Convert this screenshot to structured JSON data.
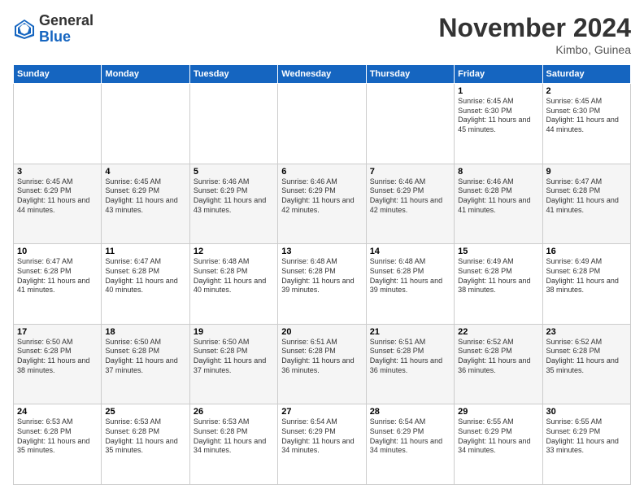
{
  "logo": {
    "general": "General",
    "blue": "Blue"
  },
  "header": {
    "month_title": "November 2024",
    "location": "Kimbo, Guinea"
  },
  "weekdays": [
    "Sunday",
    "Monday",
    "Tuesday",
    "Wednesday",
    "Thursday",
    "Friday",
    "Saturday"
  ],
  "weeks": [
    [
      {
        "day": "",
        "info": ""
      },
      {
        "day": "",
        "info": ""
      },
      {
        "day": "",
        "info": ""
      },
      {
        "day": "",
        "info": ""
      },
      {
        "day": "",
        "info": ""
      },
      {
        "day": "1",
        "info": "Sunrise: 6:45 AM\nSunset: 6:30 PM\nDaylight: 11 hours and 45 minutes."
      },
      {
        "day": "2",
        "info": "Sunrise: 6:45 AM\nSunset: 6:30 PM\nDaylight: 11 hours and 44 minutes."
      }
    ],
    [
      {
        "day": "3",
        "info": "Sunrise: 6:45 AM\nSunset: 6:29 PM\nDaylight: 11 hours and 44 minutes."
      },
      {
        "day": "4",
        "info": "Sunrise: 6:45 AM\nSunset: 6:29 PM\nDaylight: 11 hours and 43 minutes."
      },
      {
        "day": "5",
        "info": "Sunrise: 6:46 AM\nSunset: 6:29 PM\nDaylight: 11 hours and 43 minutes."
      },
      {
        "day": "6",
        "info": "Sunrise: 6:46 AM\nSunset: 6:29 PM\nDaylight: 11 hours and 42 minutes."
      },
      {
        "day": "7",
        "info": "Sunrise: 6:46 AM\nSunset: 6:29 PM\nDaylight: 11 hours and 42 minutes."
      },
      {
        "day": "8",
        "info": "Sunrise: 6:46 AM\nSunset: 6:28 PM\nDaylight: 11 hours and 41 minutes."
      },
      {
        "day": "9",
        "info": "Sunrise: 6:47 AM\nSunset: 6:28 PM\nDaylight: 11 hours and 41 minutes."
      }
    ],
    [
      {
        "day": "10",
        "info": "Sunrise: 6:47 AM\nSunset: 6:28 PM\nDaylight: 11 hours and 41 minutes."
      },
      {
        "day": "11",
        "info": "Sunrise: 6:47 AM\nSunset: 6:28 PM\nDaylight: 11 hours and 40 minutes."
      },
      {
        "day": "12",
        "info": "Sunrise: 6:48 AM\nSunset: 6:28 PM\nDaylight: 11 hours and 40 minutes."
      },
      {
        "day": "13",
        "info": "Sunrise: 6:48 AM\nSunset: 6:28 PM\nDaylight: 11 hours and 39 minutes."
      },
      {
        "day": "14",
        "info": "Sunrise: 6:48 AM\nSunset: 6:28 PM\nDaylight: 11 hours and 39 minutes."
      },
      {
        "day": "15",
        "info": "Sunrise: 6:49 AM\nSunset: 6:28 PM\nDaylight: 11 hours and 38 minutes."
      },
      {
        "day": "16",
        "info": "Sunrise: 6:49 AM\nSunset: 6:28 PM\nDaylight: 11 hours and 38 minutes."
      }
    ],
    [
      {
        "day": "17",
        "info": "Sunrise: 6:50 AM\nSunset: 6:28 PM\nDaylight: 11 hours and 38 minutes."
      },
      {
        "day": "18",
        "info": "Sunrise: 6:50 AM\nSunset: 6:28 PM\nDaylight: 11 hours and 37 minutes."
      },
      {
        "day": "19",
        "info": "Sunrise: 6:50 AM\nSunset: 6:28 PM\nDaylight: 11 hours and 37 minutes."
      },
      {
        "day": "20",
        "info": "Sunrise: 6:51 AM\nSunset: 6:28 PM\nDaylight: 11 hours and 36 minutes."
      },
      {
        "day": "21",
        "info": "Sunrise: 6:51 AM\nSunset: 6:28 PM\nDaylight: 11 hours and 36 minutes."
      },
      {
        "day": "22",
        "info": "Sunrise: 6:52 AM\nSunset: 6:28 PM\nDaylight: 11 hours and 36 minutes."
      },
      {
        "day": "23",
        "info": "Sunrise: 6:52 AM\nSunset: 6:28 PM\nDaylight: 11 hours and 35 minutes."
      }
    ],
    [
      {
        "day": "24",
        "info": "Sunrise: 6:53 AM\nSunset: 6:28 PM\nDaylight: 11 hours and 35 minutes."
      },
      {
        "day": "25",
        "info": "Sunrise: 6:53 AM\nSunset: 6:28 PM\nDaylight: 11 hours and 35 minutes."
      },
      {
        "day": "26",
        "info": "Sunrise: 6:53 AM\nSunset: 6:28 PM\nDaylight: 11 hours and 34 minutes."
      },
      {
        "day": "27",
        "info": "Sunrise: 6:54 AM\nSunset: 6:29 PM\nDaylight: 11 hours and 34 minutes."
      },
      {
        "day": "28",
        "info": "Sunrise: 6:54 AM\nSunset: 6:29 PM\nDaylight: 11 hours and 34 minutes."
      },
      {
        "day": "29",
        "info": "Sunrise: 6:55 AM\nSunset: 6:29 PM\nDaylight: 11 hours and 34 minutes."
      },
      {
        "day": "30",
        "info": "Sunrise: 6:55 AM\nSunset: 6:29 PM\nDaylight: 11 hours and 33 minutes."
      }
    ]
  ]
}
